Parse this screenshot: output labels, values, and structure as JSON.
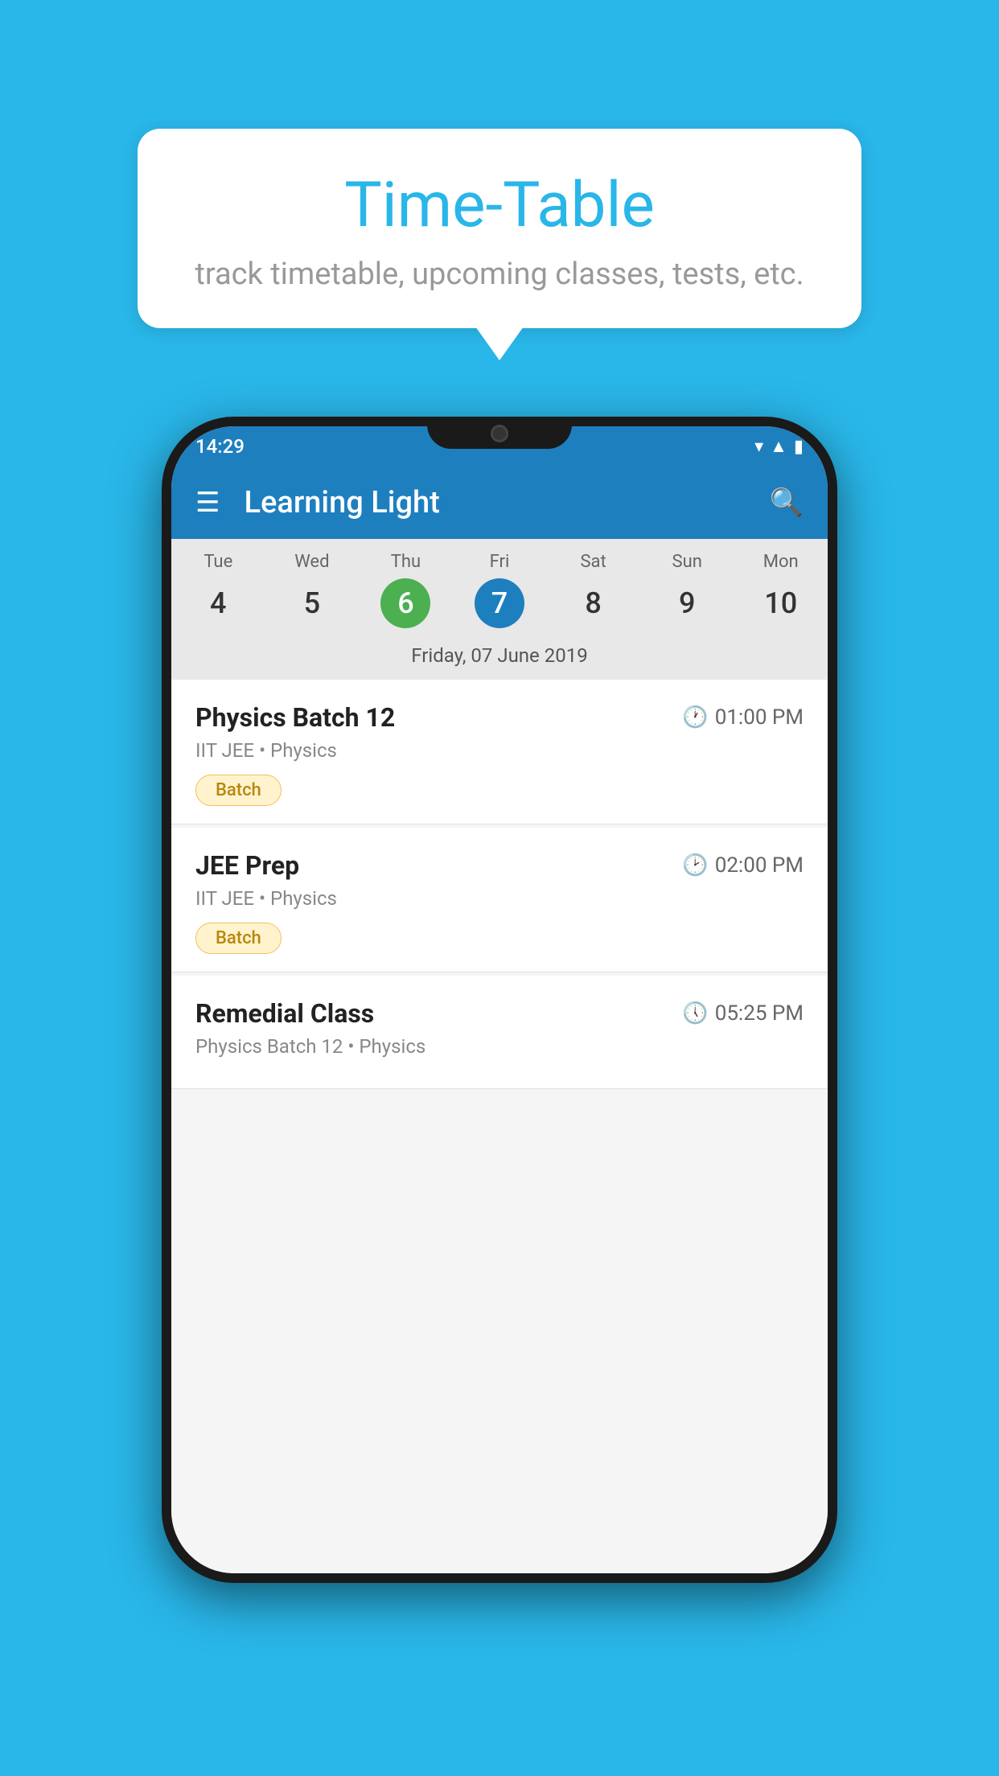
{
  "background_color": "#29b6e8",
  "bubble": {
    "title": "Time-Table",
    "subtitle": "track timetable, upcoming classes, tests, etc."
  },
  "phone": {
    "status_bar": {
      "time": "14:29",
      "icons": [
        "wifi",
        "signal",
        "battery"
      ]
    },
    "app_bar": {
      "title": "Learning Light",
      "menu_label": "☰",
      "search_label": "🔍"
    },
    "calendar": {
      "days": [
        {
          "name": "Tue",
          "number": "4",
          "state": "normal"
        },
        {
          "name": "Wed",
          "number": "5",
          "state": "normal"
        },
        {
          "name": "Thu",
          "number": "6",
          "state": "today"
        },
        {
          "name": "Fri",
          "number": "7",
          "state": "selected"
        },
        {
          "name": "Sat",
          "number": "8",
          "state": "normal"
        },
        {
          "name": "Sun",
          "number": "9",
          "state": "normal"
        },
        {
          "name": "Mon",
          "number": "10",
          "state": "normal"
        }
      ],
      "selected_date_label": "Friday, 07 June 2019"
    },
    "schedule": [
      {
        "title": "Physics Batch 12",
        "time": "01:00 PM",
        "subtitle": "IIT JEE • Physics",
        "badge": "Batch"
      },
      {
        "title": "JEE Prep",
        "time": "02:00 PM",
        "subtitle": "IIT JEE • Physics",
        "badge": "Batch"
      },
      {
        "title": "Remedial Class",
        "time": "05:25 PM",
        "subtitle": "Physics Batch 12 • Physics",
        "badge": null
      }
    ]
  }
}
